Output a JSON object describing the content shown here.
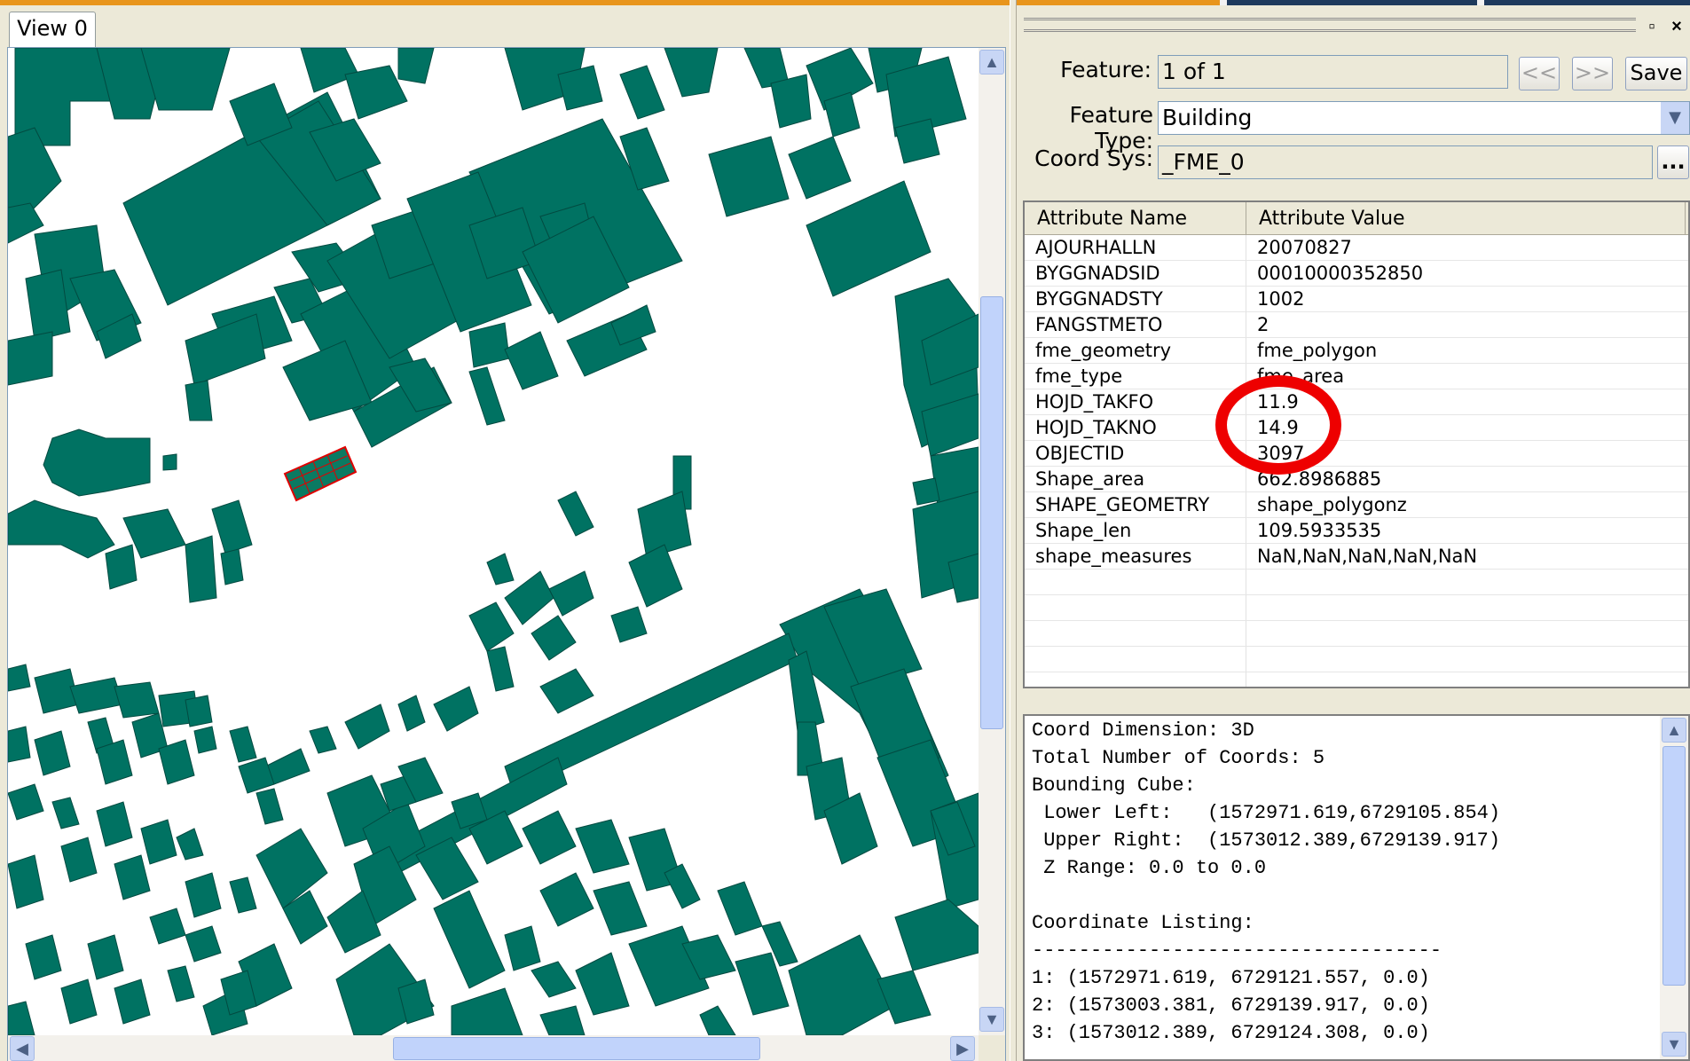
{
  "window": {
    "tab_label": "View 0",
    "restore_label": "▫",
    "close_label": "×"
  },
  "feature_panel": {
    "feature_label": "Feature:",
    "feature_value": "1 of 1",
    "prev_label": "<<",
    "next_label": ">>",
    "save_label": "Save",
    "feature_type_label": "Feature Type:",
    "feature_type_value": "Building",
    "coord_sys_label": "Coord Sys:",
    "coord_sys_value": "_FME_0",
    "browse_label": "..."
  },
  "attributes": {
    "col_name": "Attribute Name",
    "col_value": "Attribute Value",
    "rows": [
      {
        "name": "AJOURHALLN",
        "value": "20070827"
      },
      {
        "name": "BYGGNADSID",
        "value": "00010000352850"
      },
      {
        "name": "BYGGNADSTY",
        "value": "1002"
      },
      {
        "name": "FANGSTMETO",
        "value": "2"
      },
      {
        "name": "fme_geometry",
        "value": "fme_polygon"
      },
      {
        "name": "fme_type",
        "value": "fme_area"
      },
      {
        "name": "HOJD_TAKFO",
        "value": "11.9"
      },
      {
        "name": "HOJD_TAKNO",
        "value": "14.9"
      },
      {
        "name": "OBJECTID",
        "value": "3097"
      },
      {
        "name": "Shape_area",
        "value": "662.8986885"
      },
      {
        "name": "SHAPE_GEOMETRY",
        "value": "shape_polygonz"
      },
      {
        "name": "Shape_len",
        "value": "109.5933535"
      },
      {
        "name": "shape_measures",
        "value": "NaN,NaN,NaN,NaN,NaN"
      }
    ]
  },
  "info": {
    "lines": [
      "Coord Dimension: 3D",
      "Total Number of Coords: 5",
      "Bounding Cube:",
      " Lower Left:   (1572971.619,6729105.854)",
      " Upper Right:  (1573012.389,6729139.917)",
      " Z Range: 0.0 to 0.0",
      "",
      "Coordinate Listing:",
      "-----------------------------------",
      "1: (1572971.619, 6729121.557, 0.0)",
      "2: (1573003.381, 6729139.917, 0.0)",
      "3: (1573012.389, 6729124.308, 0.0)"
    ]
  },
  "scroll": {
    "up_arrow": "▲",
    "down_arrow": "▼",
    "left_arrow": "◀",
    "right_arrow": "▶"
  },
  "colors": {
    "building_fill": "#007262",
    "selected_outline": "#e00000",
    "annotation_circle": "#ee0000",
    "top_strip_orange": "#e8951c",
    "top_strip_navy": "#1e3a5c"
  }
}
